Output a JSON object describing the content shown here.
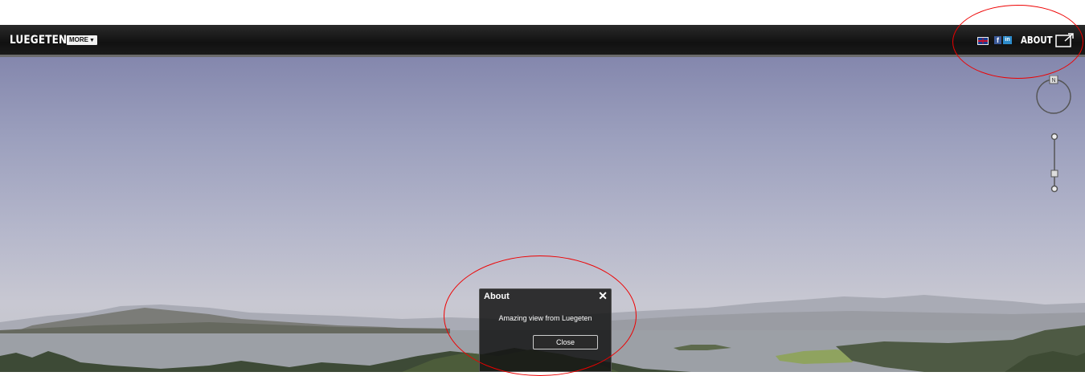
{
  "header": {
    "brand": "LUEGETEN",
    "more_label": "MORE",
    "more_arrow": "▼",
    "facebook_glyph": "f",
    "linkedin_glyph": "in",
    "about_label": "ABOUT"
  },
  "icons": {
    "flag": "uk-flag-icon",
    "share": "fullscreen-share-icon",
    "compass": "compass-icon",
    "zoom": "zoom-slider-icon"
  },
  "dialog": {
    "title": "About",
    "close_glyph": "✕",
    "message": "Amazing view from Luegeten",
    "button_label": "Close"
  },
  "colors": {
    "topbar": "#141414",
    "annotation": "#e00000",
    "sky_top": "#8487ad",
    "sky_bottom": "#c8c8d2"
  }
}
